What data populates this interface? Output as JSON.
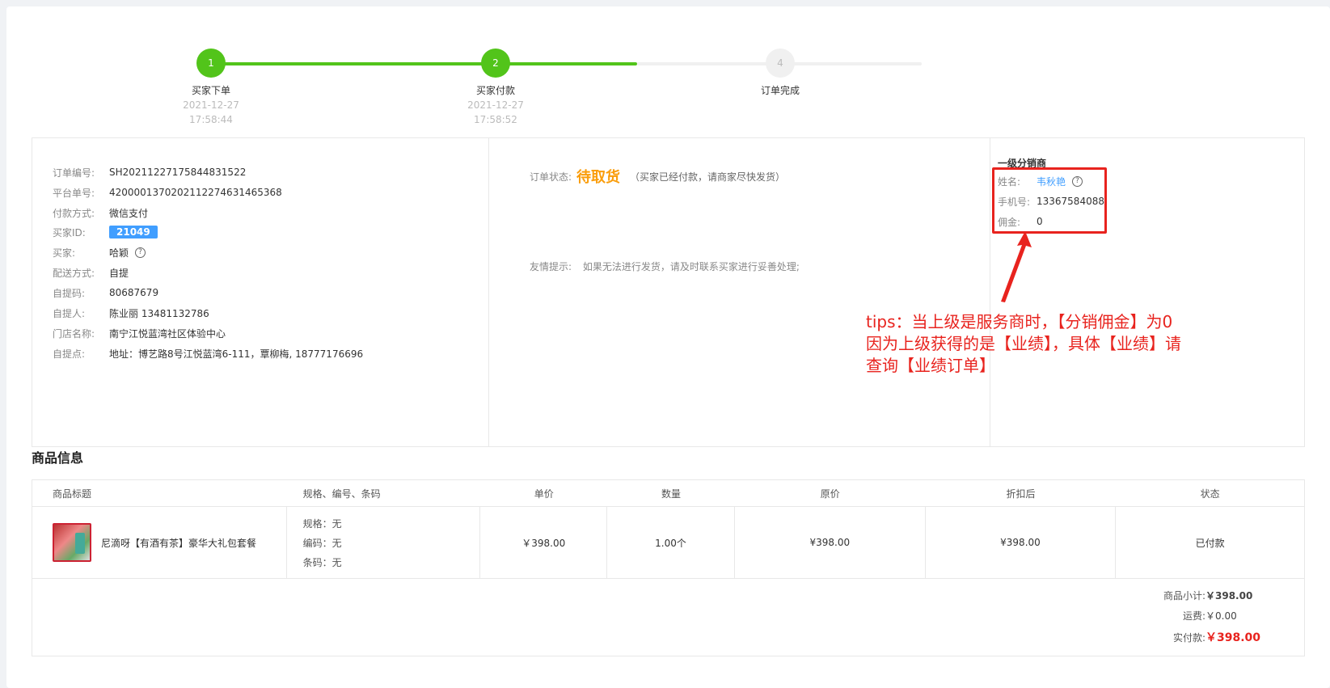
{
  "steps": [
    {
      "index": "1",
      "title": "买家下单",
      "date": "2021-12-27",
      "time": "17:58:44",
      "state": "done"
    },
    {
      "index": "2",
      "title": "买家付款",
      "date": "2021-12-27",
      "time": "17:58:52",
      "state": "done"
    },
    {
      "index": "4",
      "title": "订单完成",
      "date": "",
      "time": "",
      "state": "todo"
    }
  ],
  "order": {
    "order_no_label": "订单编号:",
    "order_no": "SH20211227175844831522",
    "platform_no_label": "平台单号:",
    "platform_no": "4200001370202112274631465368",
    "pay_label": "付款方式:",
    "pay": "微信支付",
    "buyer_id_label": "买家ID:",
    "buyer_id": "21049",
    "buyer_label": "买家:",
    "buyer": "哈颖",
    "delivery_label": "配送方式:",
    "delivery": "自提",
    "pickup_code_label": "自提码:",
    "pickup_code": "80687679",
    "pickup_person_label": "自提人:",
    "pickup_person": "陈业丽 13481132786",
    "store_label": "门店名称:",
    "store": "南宁江悦蓝湾社区体验中心",
    "pickup_point_label": "自提点:",
    "pickup_point": "地址：博艺路8号江悦蓝湾6-111，覃柳梅, 18777176696"
  },
  "status": {
    "label": "订单状态:",
    "value": "待取货",
    "note": "（买家已经付款，请商家尽快发货）",
    "tip_label": "友情提示:",
    "tip": "如果无法进行发货，请及时联系买家进行妥善处理;"
  },
  "distributor": {
    "title": "一级分销商",
    "name_label": "姓名:",
    "name": "韦秋艳",
    "phone_label": "手机号:",
    "phone": "13367584088",
    "commission_label": "佣金:",
    "commission": "0"
  },
  "annotation": {
    "line1": "tips：当上级是服务商时，【分销佣金】为0",
    "line2": "因为上级获得的是【业绩】，具体【业绩】请",
    "line3": "查询【业绩订单】"
  },
  "products": {
    "section_title": "商品信息",
    "headers": [
      "商品标题",
      "规格、编号、条码",
      "单价",
      "数量",
      "原价",
      "折扣后",
      "状态"
    ],
    "rows": [
      {
        "name": "尼滴呀【有酒有茶】豪华大礼包套餐",
        "spec": "规格：无",
        "code": "编码：无",
        "barcode": "条码：无",
        "price": "￥398.00",
        "qty": "1.00个",
        "original": "¥398.00",
        "discounted": "¥398.00",
        "status": "已付款"
      }
    ],
    "subtotal_label": "商品小计:",
    "subtotal": "￥398.00",
    "shipping_label": "运费:",
    "shipping": "￥0.00",
    "paid_label": "实付款:",
    "paid": "￥398.00"
  },
  "colors": {
    "step_done": "#52c41a",
    "accent": "#409eff",
    "status": "#fa9d0b",
    "annotation": "#e8231e"
  }
}
